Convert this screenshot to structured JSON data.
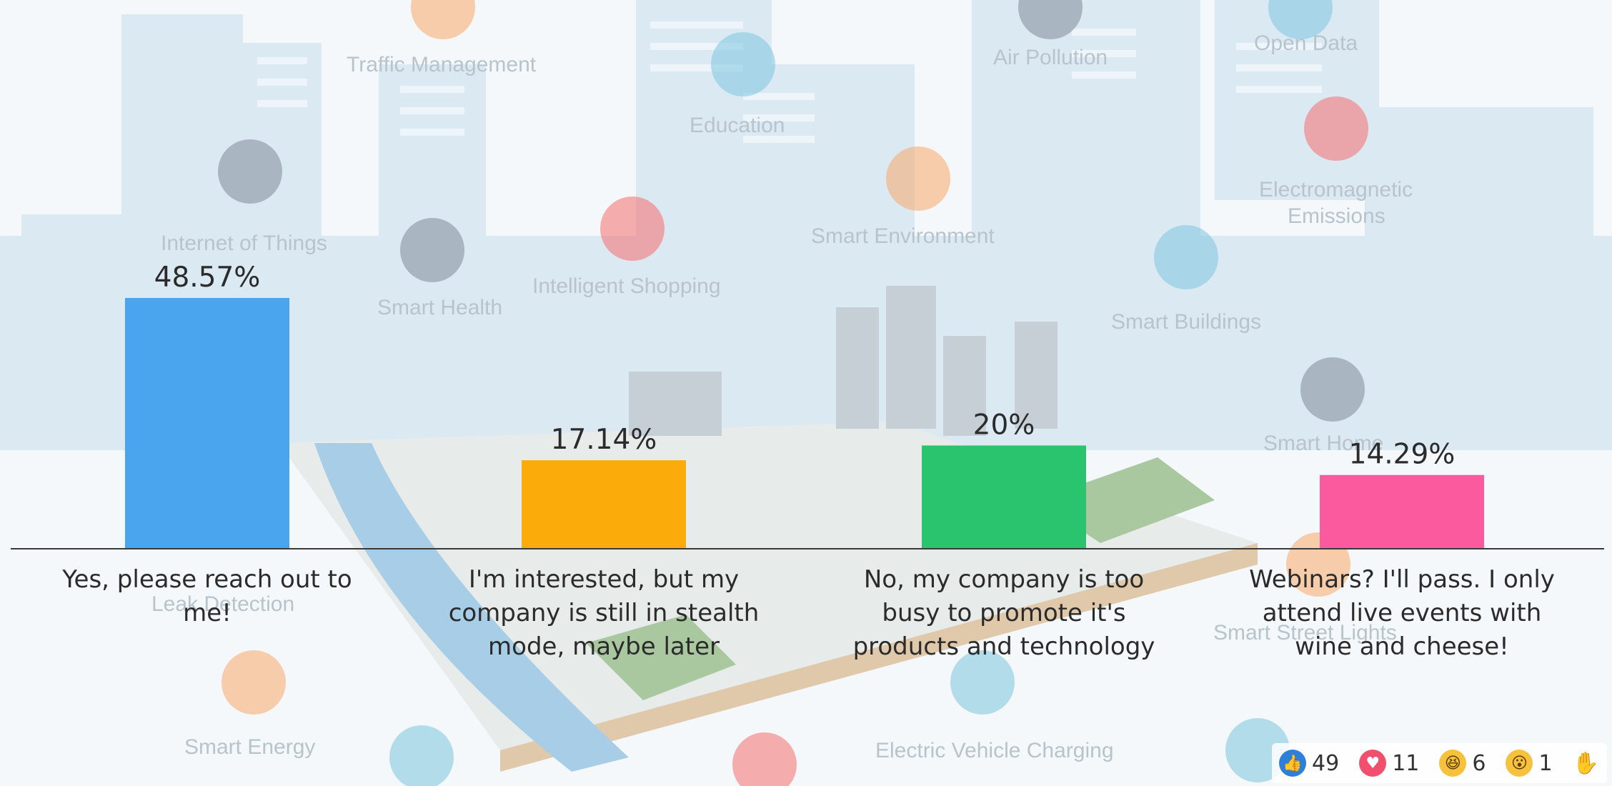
{
  "background_labels": [
    "Traffic Management",
    "Education",
    "Air Pollution",
    "Open Data",
    "Internet of Things",
    "Smart Health",
    "Intelligent Shopping",
    "Smart Environment",
    "Smart Buildings",
    "Electromagnetic",
    "Emissions",
    "Smart Home",
    "Leak Detection",
    "Smart Street Lights",
    "Smart Energy",
    "Electric Vehicle Charging"
  ],
  "chart_data": {
    "type": "bar",
    "categories": [
      [
        "Yes, please reach out to",
        "me!"
      ],
      [
        "I'm interested, but my",
        "company is still in stealth",
        "mode, maybe later"
      ],
      [
        "No, my company is too",
        "busy to promote it's",
        "products and technology"
      ],
      [
        "Webinars? I'll pass. I only",
        "attend live events with",
        "wine and cheese!"
      ]
    ],
    "values": [
      48.57,
      17.14,
      20,
      14.29
    ],
    "value_labels": [
      "48.57%",
      "17.14%",
      "20%",
      "14.29%"
    ],
    "colors": [
      "#4aa5ee",
      "#fcac0a",
      "#2ac46e",
      "#fc5a9e"
    ],
    "ylim": [
      0,
      48.57
    ],
    "grid": false,
    "legend": "none"
  },
  "reactions": [
    {
      "icon": "thumbs-up-icon",
      "count": "49",
      "color": "#2f7fd9"
    },
    {
      "icon": "heart-icon",
      "count": "11",
      "color": "#f0506e"
    },
    {
      "icon": "laugh-icon",
      "count": "6",
      "color": "#f7c23b"
    },
    {
      "icon": "wow-icon",
      "count": "1",
      "color": "#f7c23b"
    }
  ]
}
